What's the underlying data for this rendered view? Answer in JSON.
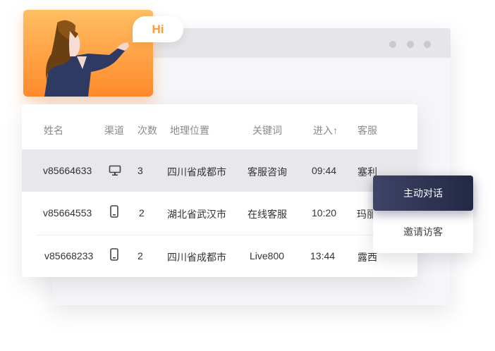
{
  "greeting": "Hi",
  "table": {
    "headers": {
      "name": "姓名",
      "channel": "渠道",
      "visits": "次数",
      "location": "地理位置",
      "keyword": "关键词",
      "entry": "进入↑",
      "agent": "客服"
    },
    "rows": [
      {
        "name": "v85664633",
        "channel": "desktop-icon",
        "visits": "3",
        "location": "四川省成都市",
        "keyword": "客服咨询",
        "entry": "09:44",
        "agent": "塞利"
      },
      {
        "name": "v85664553",
        "channel": "mobile-icon",
        "visits": "2",
        "location": "湖北省武汉市",
        "keyword": "在线客服",
        "entry": "10:20",
        "agent": "玛丽"
      },
      {
        "name": "v85668233",
        "channel": "mobile-icon",
        "visits": "2",
        "location": "四川省成都市",
        "keyword": "Live800",
        "entry": "13:44",
        "agent": "露西"
      }
    ]
  },
  "menu": {
    "primary": "主动对话",
    "secondary": "邀请访客"
  },
  "colors": {
    "accent_orange": "#ff9a3a",
    "primary_button": "#2b3050",
    "highlight_row": "#e8e8ec"
  }
}
